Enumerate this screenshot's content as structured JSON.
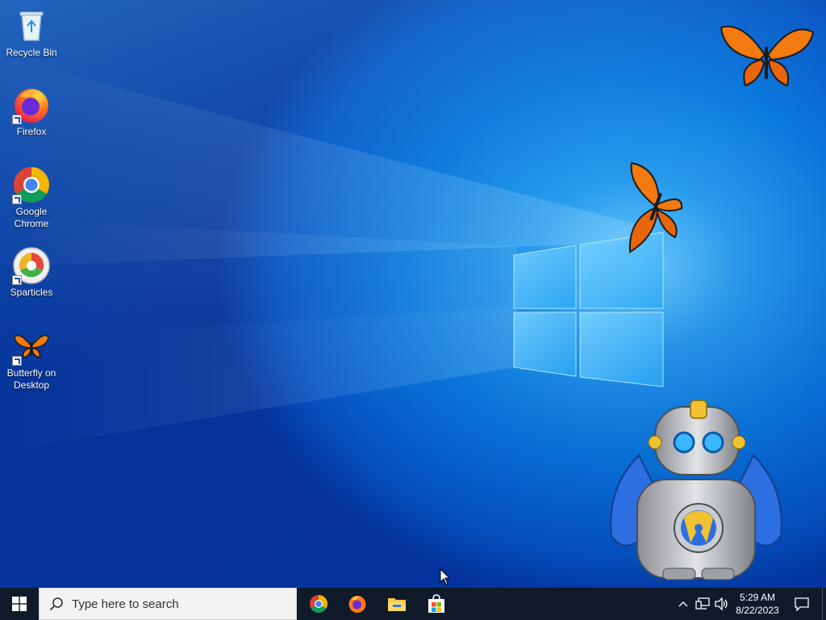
{
  "desktop": {
    "icons": [
      {
        "label": "Recycle Bin",
        "icon": "recycle-bin-icon"
      },
      {
        "label": "Firefox",
        "icon": "firefox-icon"
      },
      {
        "label": "Google Chrome",
        "icon": "chrome-icon"
      },
      {
        "label": "Sparticles",
        "icon": "sparticles-icon"
      },
      {
        "label": "Butterfly on Desktop",
        "icon": "butterfly-icon"
      }
    ],
    "decorations": [
      "butterfly-icon",
      "butterfly-icon",
      "robot-mascot"
    ]
  },
  "taskbar": {
    "start_icon": "windows-logo-icon",
    "search_placeholder": "Type here to search",
    "pinned_apps": [
      "chrome-icon",
      "firefox-icon",
      "file-explorer-icon",
      "microsoft-store-icon"
    ],
    "tray_icons": [
      "chevron-up-icon",
      "network-icon",
      "volume-icon"
    ],
    "clock": {
      "time": "5:29 AM",
      "date": "8/22/2023"
    },
    "notification_icon": "notification-icon"
  },
  "colors": {
    "taskbar_bg": "#101a2b",
    "desktop_accent": "#0a79dd"
  }
}
